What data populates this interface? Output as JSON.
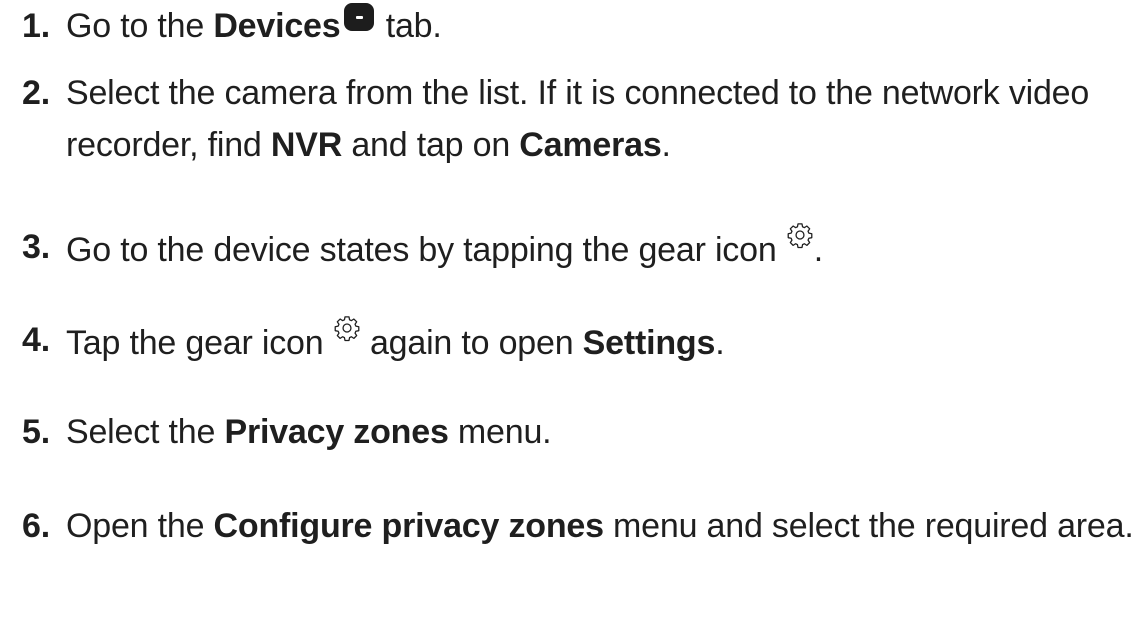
{
  "steps": [
    {
      "number": "1.",
      "parts": [
        "Go to the ",
        "Devices",
        " tab."
      ]
    },
    {
      "number": "2.",
      "parts": [
        "Select the camera from the list. If it is connected to the network video recorder, find ",
        "NVR",
        " and tap on ",
        "Cameras",
        "."
      ]
    },
    {
      "number": "3.",
      "parts": [
        "Go to the device states by tapping the gear icon ",
        "."
      ]
    },
    {
      "number": "4.",
      "parts": [
        "Tap the gear icon ",
        " again to open ",
        "Settings",
        "."
      ]
    },
    {
      "number": "5.",
      "parts": [
        "Select the ",
        "Privacy zones",
        " menu."
      ]
    },
    {
      "number": "6.",
      "parts": [
        "Open the ",
        "Configure privacy zones",
        " menu and select the required area."
      ]
    }
  ],
  "icons": {
    "devices_tab": "devices-tab-icon",
    "gear": "gear-icon"
  }
}
